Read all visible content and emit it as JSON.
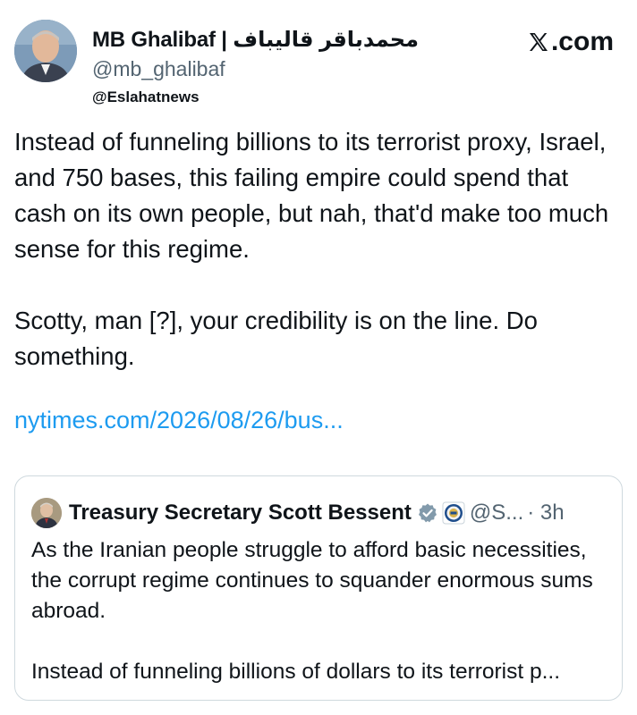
{
  "author": {
    "display_name": "MB Ghalibaf | محمدباقر قالیباف",
    "handle": "@mb_ghalibaf",
    "source_tag": "@Eslahatnews"
  },
  "brand": {
    "label": ".com",
    "icon": "x-logo-icon"
  },
  "tweet": {
    "paragraph1": "Instead of funneling billions to its terrorist proxy, Israel, and 750 bases, this failing empire could spend that cash on its own people, but nah, that'd make too much sense for this regime.",
    "paragraph2": "Scotty, man [?], your credibility is on the line. Do something.",
    "link": "nytimes.com/2026/08/26/bus..."
  },
  "quoted": {
    "name": "Treasury Secretary Scott Bessent",
    "handle": "@S...",
    "time": "· 3h",
    "badges": [
      "government-verified-icon",
      "treasury-seal-icon"
    ],
    "paragraph1": "As the Iranian people struggle to afford basic necessities, the corrupt regime continues to squander enormous sums abroad.",
    "paragraph2": "Instead of funneling billions of dollars to its terrorist p..."
  },
  "colors": {
    "text": "#0f1419",
    "secondary": "#536471",
    "link": "#1d9bf0",
    "border": "#cfd9de"
  }
}
